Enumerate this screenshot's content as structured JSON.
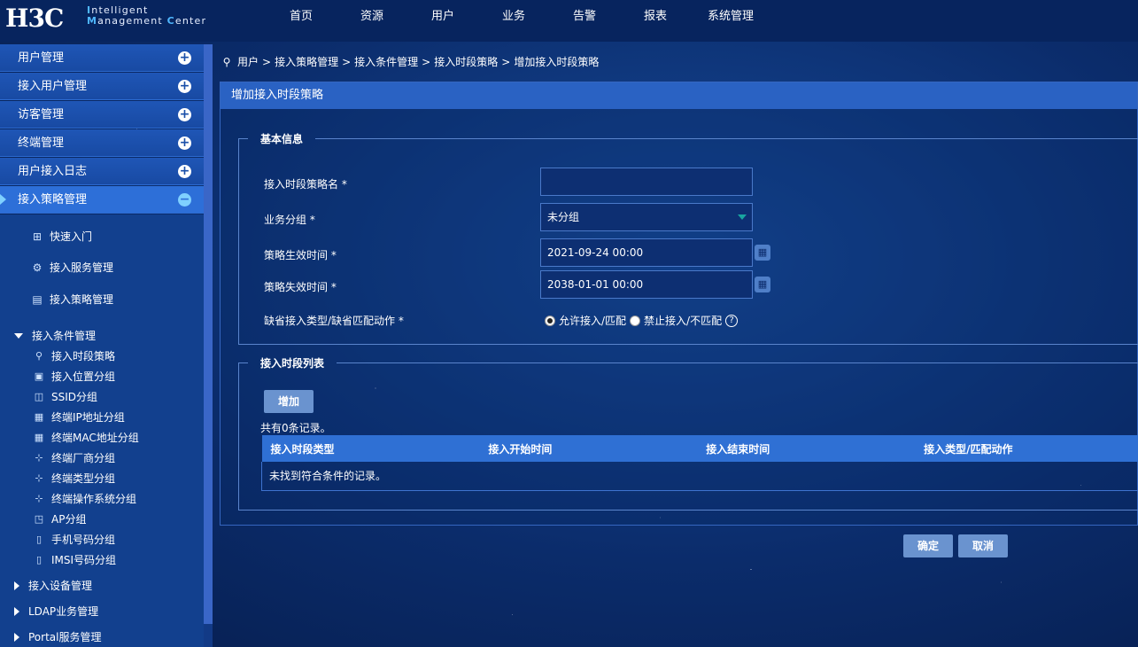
{
  "header": {
    "logo_main": "H3C",
    "logo_line1_initial": "I",
    "logo_line1_rest": "ntelligent",
    "logo_line2_initial1": "M",
    "logo_line2_rest1": "anagement ",
    "logo_line2_initial2": "C",
    "logo_line2_rest2": "enter",
    "nav": [
      "首页",
      "资源",
      "用户",
      "业务",
      "告警",
      "报表",
      "系统管理"
    ]
  },
  "sidebar": {
    "sections": [
      {
        "label": "用户管理",
        "icon": "plus-circle-icon"
      },
      {
        "label": "接入用户管理",
        "icon": "plus-circle-icon"
      },
      {
        "label": "访客管理",
        "icon": "plus-circle-icon"
      },
      {
        "label": "终端管理",
        "icon": "plus-circle-icon"
      },
      {
        "label": "用户接入日志",
        "icon": "plus-circle-icon"
      },
      {
        "label": "接入策略管理",
        "icon": "minus-circle-icon",
        "active": true
      }
    ],
    "sub_entries": [
      {
        "label": "快速入门",
        "icon": "quick-start-icon"
      },
      {
        "label": "接入服务管理",
        "icon": "service-icon"
      },
      {
        "label": "接入策略管理",
        "icon": "policy-icon"
      }
    ],
    "condition_group": "接入条件管理",
    "condition_items": [
      {
        "label": "接入时段策略",
        "icon": "time-policy-icon"
      },
      {
        "label": "接入位置分组",
        "icon": "location-icon"
      },
      {
        "label": "SSID分组",
        "icon": "ssid-icon"
      },
      {
        "label": "终端IP地址分组",
        "icon": "ip-icon"
      },
      {
        "label": "终端MAC地址分组",
        "icon": "mac-icon"
      },
      {
        "label": "终端厂商分组",
        "icon": "vendor-icon"
      },
      {
        "label": "终端类型分组",
        "icon": "terminal-type-icon"
      },
      {
        "label": "终端操作系统分组",
        "icon": "os-icon"
      },
      {
        "label": "AP分组",
        "icon": "ap-icon"
      },
      {
        "label": "手机号码分组",
        "icon": "phone-icon"
      },
      {
        "label": "IMSI号码分组",
        "icon": "imsi-icon"
      }
    ],
    "collapsed_groups": [
      "接入设备管理",
      "LDAP业务管理",
      "Portal服务管理"
    ]
  },
  "breadcrumb": {
    "items": [
      "用户",
      "接入策略管理",
      "接入条件管理",
      "接入时段策略",
      "增加接入时段策略"
    ],
    "separator": ">"
  },
  "panel": {
    "title": "增加接入时段策略",
    "basic_info": {
      "legend": "基本信息",
      "fields": {
        "name_label": "接入时段策略名",
        "name_value": "",
        "group_label": "业务分组",
        "group_value": "未分组",
        "start_label": "策略生效时间",
        "start_value": "2021-09-24 00:00",
        "end_label": "策略失效时间",
        "end_value": "2038-01-01 00:00",
        "default_action_label": "缺省接入类型/缺省匹配动作",
        "radio_allow": "允许接入/匹配",
        "radio_deny": "禁止接入/不匹配",
        "required_mark": "*"
      }
    },
    "period_list": {
      "legend": "接入时段列表",
      "add_button": "增加",
      "count_text": "共有0条记录。",
      "columns": [
        "接入时段类型",
        "接入开始时间",
        "接入结束时间",
        "接入类型/匹配动作"
      ],
      "empty_text": "未找到符合条件的记录。"
    }
  },
  "actions": {
    "confirm": "确定",
    "cancel": "取消"
  }
}
